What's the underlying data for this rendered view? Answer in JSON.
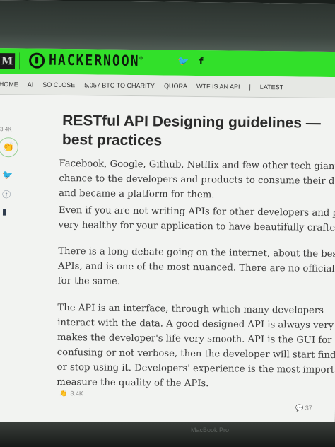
{
  "header": {
    "m_logo": "M",
    "brand": "HACKERNOON",
    "brand_mark": "®",
    "social_twitter": "🐦",
    "social_facebook": "f"
  },
  "nav": {
    "items": [
      "HOME",
      "AI",
      "SO CLOSE",
      "5,057 BTC TO CHARITY",
      "QUORA",
      "WTF IS AN API",
      "LATEST"
    ]
  },
  "rail": {
    "clap_count": "3.4K",
    "clap_glyph": "👏",
    "twitter_glyph": "🐦",
    "facebook_glyph": "ⓕ",
    "bookmark_glyph": "▮"
  },
  "article": {
    "title_line1": "RESTful API Designing guidelines —",
    "title_line2": "best practices",
    "paragraphs": [
      "Facebook, Google, Github, Netflix and few other tech giants have",
      "chance to the developers and products to consume their data thr",
      "and became a platform for them.",
      "Even if you are not writing APIs for other developers and product",
      "very healthy for your application to have beautifully crafted APIs.",
      "There is a long debate going on the internet, about the best ways t",
      "APIs, and is one of the most nuanced. There are no official guidelin",
      "for the same.",
      "The API is an interface, through which many developers",
      "interact with the data. A good designed API is always very easy to u",
      "makes the developer's life very smooth. API is the GUI for develope",
      "confusing or not verbose, then the developer will start finding the a",
      "or stop using it. Developers' experience is the most important metri",
      "measure the quality of the APIs."
    ],
    "bottom_clap": "3.4K",
    "bottom_right": "37"
  },
  "bezel": {
    "label": "MacBook Pro"
  }
}
